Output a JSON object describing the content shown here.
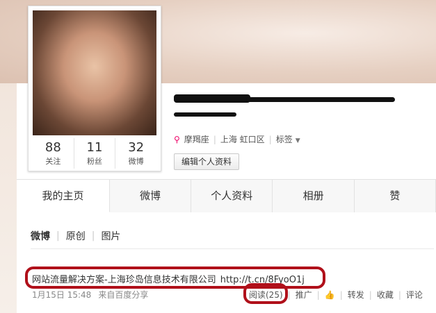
{
  "profile": {
    "stats": [
      {
        "num": "88",
        "label": "关注"
      },
      {
        "num": "11",
        "label": "粉丝"
      },
      {
        "num": "32",
        "label": "微博"
      }
    ],
    "zodiac": "摩羯座",
    "location": "上海 虹口区",
    "tags_label": "标签",
    "edit_button": "编辑个人资料"
  },
  "tabs": [
    {
      "label": "我的主页",
      "active": true
    },
    {
      "label": "微博"
    },
    {
      "label": "个人资料"
    },
    {
      "label": "相册"
    },
    {
      "label": "赞"
    }
  ],
  "feed": {
    "subtabs": [
      "微博",
      "原创",
      "图片"
    ],
    "post": {
      "text": "网站流量解决方案-上海珍岛信息技术有限公司",
      "link": "http://t.cn/8FyoO1j",
      "date": "1月15日 15:48",
      "source": "来自百度分享",
      "read": "阅读(25)",
      "promote": "推广",
      "repost": "转发",
      "favorite": "收藏",
      "comment": "评论"
    }
  },
  "icons": {
    "location": "location-pin-icon",
    "like": "thumbs-up-icon",
    "dropdown": "chevron-down-icon"
  },
  "colors": {
    "annotation_circle": "#b0101a",
    "like_icon": "#3b7bd4"
  }
}
